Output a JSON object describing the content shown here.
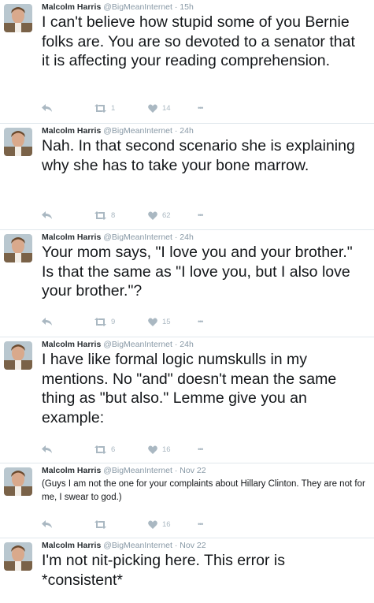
{
  "tweets": [
    {
      "name": "Malcolm Harris",
      "handle": "@BigMeanInternet",
      "time": "15h",
      "text": "I can't believe how stupid some of you Bernie folks are. You are so devoted to a senator that it is affecting your reading comprehension.",
      "retweets": "1",
      "likes": "14"
    },
    {
      "name": "Malcolm Harris",
      "handle": "@BigMeanInternet",
      "time": "24h",
      "text": "Nah. In that second scenario she is explaining why she has to take your bone marrow.",
      "retweets": "8",
      "likes": "62"
    },
    {
      "name": "Malcolm Harris",
      "handle": "@BigMeanInternet",
      "time": "24h",
      "text": "Your mom says, \"I love you and your brother.\" Is that the same as \"I love you, but I also love your brother.\"?",
      "retweets": "9",
      "likes": "15"
    },
    {
      "name": "Malcolm Harris",
      "handle": "@BigMeanInternet",
      "time": "24h",
      "text": "I have like formal logic numskulls in my mentions. No \"and\" doesn't mean the same thing as \"but also.\" Lemme give you an example:",
      "retweets": "6",
      "likes": "16"
    },
    {
      "name": "Malcolm Harris",
      "handle": "@BigMeanInternet",
      "time": "Nov 22",
      "text": "(Guys I am not the one for your complaints about Hillary Clinton. They are not for me, I swear to god.)",
      "retweets": "",
      "likes": "16"
    },
    {
      "name": "Malcolm Harris",
      "handle": "@BigMeanInternet",
      "time": "Nov 22",
      "text": "I'm not nit-picking here. This error is *consistent*"
    }
  ],
  "separator": "·",
  "more_glyph": "•••",
  "icons": [
    "reply-icon",
    "retweet-icon",
    "like-icon",
    "more-icon"
  ],
  "colors": {
    "text": "#14171a",
    "meta": "#8899a6",
    "action": "#aab8c2",
    "border": "#e1e8ed"
  }
}
